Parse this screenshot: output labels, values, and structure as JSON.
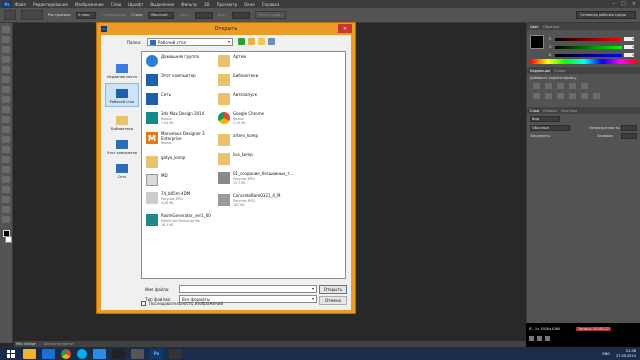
{
  "menubar": {
    "logo": "Ps",
    "items": [
      "Файл",
      "Редактирование",
      "Изображение",
      "Слои",
      "Шрифт",
      "Выделение",
      "Фильтр",
      "3D",
      "Просмотр",
      "Окно",
      "Справка"
    ],
    "controls": [
      "–",
      "□",
      "×"
    ]
  },
  "options": {
    "feather_label": "Растушевка:",
    "feather_value": "0 пикс",
    "smoothing_label": "Сглаживание",
    "style_label": "Стиль:",
    "style_value": "Обычный",
    "width_label": "Шир.:",
    "height_label": "Выс.:",
    "refine_label": "Уточн. край...",
    "workspace": "Основная рабочая среда"
  },
  "panels": {
    "color_tabs": [
      "Цвет",
      "Образцы"
    ],
    "sliders": [
      {
        "label": "R",
        "value": "0"
      },
      {
        "label": "G",
        "value": "0"
      },
      {
        "label": "B",
        "value": "0"
      }
    ],
    "adjust_tabs": [
      "Коррекция",
      "Стили"
    ],
    "adjust_title": "Добавить корректировку",
    "layers_tabs": [
      "Слои",
      "Каналы",
      "Контуры"
    ],
    "kind": "Вид",
    "blend": "Обычные",
    "opacity_label": "Непрозрачность:",
    "lock_label": "Закрепить:",
    "fill_label": "Заливка:"
  },
  "statusbar": {
    "items": [
      "Mini Bridge",
      "Шкала времени"
    ]
  },
  "player": {
    "info": "Я - 1ч 1920x1080",
    "time": "Запись: 00:00:22"
  },
  "dialog": {
    "title": "Открыть",
    "logo": "Ps",
    "close": "×",
    "folder_label": "Папка:",
    "folder_value": "Рабочий стол",
    "places": [
      {
        "label": "Недавние места",
        "selected": false
      },
      {
        "label": "Рабочий стол",
        "selected": true
      },
      {
        "label": "Библиотеки",
        "selected": false
      },
      {
        "label": "Этот компьютер",
        "selected": false
      },
      {
        "label": "Сеть",
        "selected": false
      }
    ],
    "files_left": [
      {
        "name": "Домашняя группа",
        "sub": ""
      },
      {
        "name": "Этот компьютер",
        "sub": ""
      },
      {
        "name": "Сеть",
        "sub": ""
      },
      {
        "name": "3ds Max Design 2014",
        "sub": "Ярлык\n1,94 КБ"
      },
      {
        "name": "Marvelous Designer 3 Enterprise",
        "sub": "Ярлык"
      },
      {
        "name": "gatya_komp",
        "sub": ""
      },
      {
        "name": "MD",
        "sub": ""
      },
      {
        "name": "74_b05m-4DM",
        "sub": "Рисунок JPEG\n4,28 КБ"
      },
      {
        "name": "RoomGenerator_ver1_00",
        "sub": "MAXScript Maxscript file\n16,3 КБ"
      }
    ],
    "files_right": [
      {
        "name": "Артем",
        "sub": ""
      },
      {
        "name": "Библиотеки",
        "sub": ""
      },
      {
        "name": "Автозапуск",
        "sub": ""
      },
      {
        "name": "Google Chrome",
        "sub": "Ярлык\n2,19 КБ"
      },
      {
        "name": "artem_komp",
        "sub": ""
      },
      {
        "name": "lisa_komp",
        "sub": ""
      },
      {
        "name": "01_создание_бесшовных_т...",
        "sub": "Рисунок JPEG\n33,7 КБ"
      },
      {
        "name": "ConcreteBare0321_4_M",
        "sub": "Рисунок JPEG\n182 КБ"
      }
    ],
    "filename_label": "Имя файла:",
    "filename_value": "",
    "filetype_label": "Тип файлов:",
    "filetype_value": "Все форматы",
    "open_button": "Открыть",
    "cancel_button": "Отмена",
    "sequence_label": "Последовательность изображений"
  },
  "taskbar": {
    "lang": "ENG",
    "time": "21:36",
    "date": "27.09.2014"
  }
}
